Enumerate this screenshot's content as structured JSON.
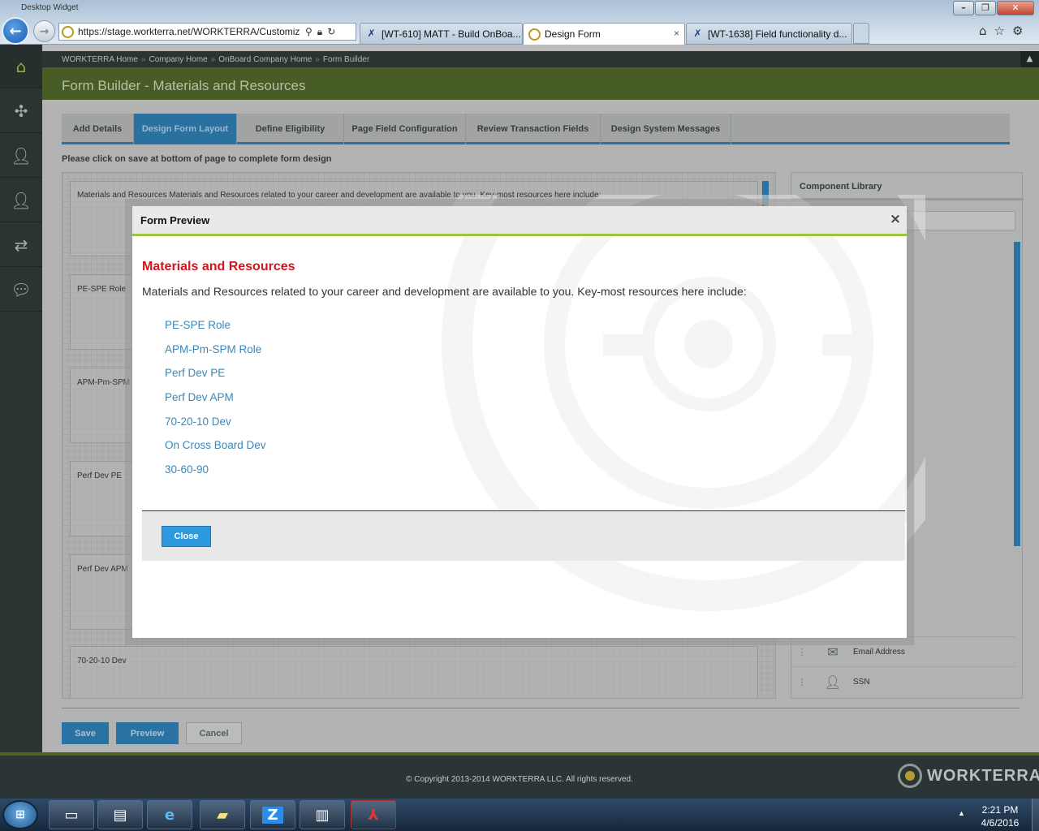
{
  "browser": {
    "window_title": "Desktop Widget",
    "address": "https://stage.workterra.net/WORKTERRA/Customiz",
    "tabs": [
      {
        "label": "[WT-610] MATT - Build OnBoa..."
      },
      {
        "label": "Design Form",
        "active": true
      },
      {
        "label": "[WT-1638] Field functionality d..."
      }
    ],
    "tab_close": "×"
  },
  "breadcrumb": [
    "WORKTERRA Home",
    "Company Home",
    "OnBoard Company Home",
    "Form Builder"
  ],
  "breadcrumb_sep": "»",
  "page_title": "Form Builder - Materials and Resources",
  "page_tabs": [
    "Add Details",
    "Design Form Layout",
    "Define Eligibility",
    "Page Field Configuration",
    "Review Transaction Fields",
    "Design System Messages"
  ],
  "save_note": "Please click on save at bottom of page to complete form design",
  "canvas_fields": [
    "Materials and Resources Materials and Resources related to your career and development are available to you. Key-most resources here include:",
    "PE-SPE Role",
    "APM-Pm-SPM",
    "Perf Dev PE",
    "Perf Dev APM",
    "70-20-10 Dev"
  ],
  "component_library": {
    "title": "Component Library",
    "items": [
      {
        "label": "Email Address",
        "icon": "envelope-icon"
      },
      {
        "label": "SSN",
        "icon": "person-icon"
      }
    ]
  },
  "actions": {
    "save": "Save",
    "preview": "Preview",
    "cancel": "Cancel"
  },
  "modal": {
    "title": "Form Preview",
    "heading": "Materials and Resources",
    "intro": "Materials and Resources related to your career and development are available to you. Key-most resources here include:",
    "links": [
      "PE-SPE Role",
      "APM-Pm-SPM Role",
      "Perf Dev PE",
      "Perf Dev APM",
      "70-20-10 Dev",
      "On Cross Board Dev",
      "30-60-90"
    ],
    "close_label": "Close",
    "x_label": "×"
  },
  "footer": {
    "copyright": "© Copyright 2013-2014 WORKTERRA LLC. All rights reserved.",
    "brand": "WORKTERRA"
  },
  "taskbar": {
    "time": "2:21 PM",
    "date": "4/6/2016",
    "apps": [
      "windows-explorer-icon",
      "file-manager-icon",
      "internet-explorer-icon",
      "sticky-notes-icon",
      "zoom-icon",
      "documents-icon",
      "acrobat-icon"
    ]
  },
  "colors": {
    "accent_blue": "#2a7db3",
    "header_green": "#4d6425",
    "heading_red": "#d0161e",
    "link_blue": "#3b87b8",
    "modal_accent": "#9bc53d"
  }
}
